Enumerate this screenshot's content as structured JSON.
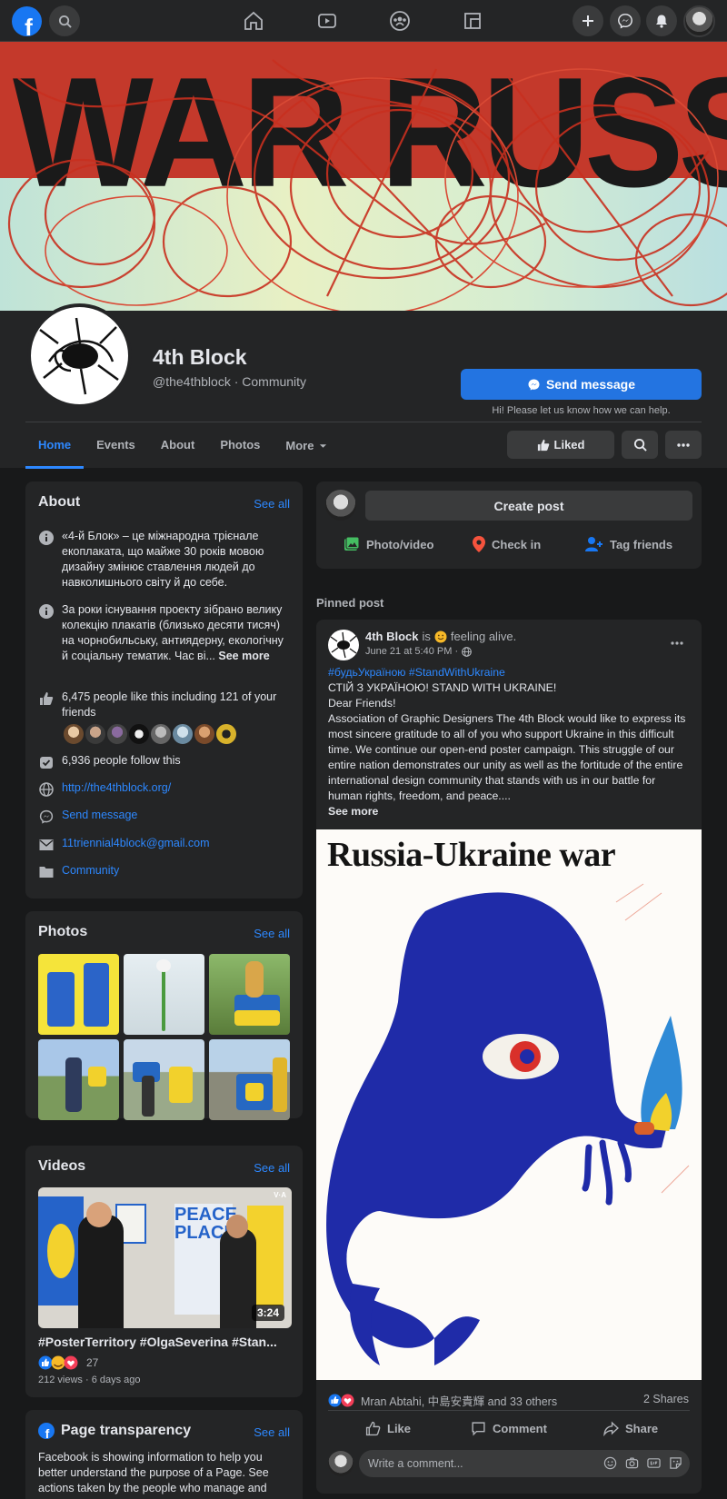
{
  "nav": {
    "logo": "f",
    "icons": [
      "search-icon",
      "home-icon",
      "watch-icon",
      "groups-icon",
      "gaming-icon",
      "plus-icon",
      "messenger-icon",
      "notifications-icon",
      "account-avatar"
    ]
  },
  "cover": {
    "text": "WAR RUSSIA"
  },
  "page": {
    "name": "4th Block",
    "handle": "@the4thblock · Community",
    "send_message": "Send message",
    "send_hint": "Hi! Please let us know how we can help."
  },
  "tabs": [
    "Home",
    "Events",
    "About",
    "Photos",
    "More"
  ],
  "header_buttons": {
    "liked": "Liked"
  },
  "about": {
    "title": "About",
    "see_all": "See all",
    "description1": "«4-й Блок» – це міжнародна трієнале екоплаката, що майже 30 років мовою дизайну змінює ставлення людей до навколишнього світу й до себе.",
    "description2": "За роки існування проекту зібрано велику колекцію плакатів (близько десяти тисяч) на чорнобильську, антиядерну, екологічну й соціальну тематик. Час ві...",
    "see_more": "See more",
    "likes": "6,475 people like this including 121 of your friends",
    "follows": "6,936 people follow this",
    "website": "http://the4thblock.org/",
    "send_message": "Send message",
    "email": "11triennial4block@gmail.com",
    "category": "Community"
  },
  "photos": {
    "title": "Photos",
    "see_all": "See all"
  },
  "videos": {
    "title": "Videos",
    "see_all": "See all",
    "duration": "3:24",
    "watermark": "V·A",
    "caption": "#PosterTerritory #OlgaSeverina #Stan...",
    "reactions": "27",
    "meta": "212 views · 6 days ago",
    "poster_text": "PEACE PLACE"
  },
  "transparency": {
    "title": "Page transparency",
    "see_all": "See all",
    "text": "Facebook is showing information to help you better understand the purpose of a Page. See actions taken by the people who manage and"
  },
  "composer": {
    "create_post": "Create post",
    "photo_video": "Photo/video",
    "check_in": "Check in",
    "tag_friends": "Tag friends"
  },
  "post": {
    "pinned_label": "Pinned post",
    "author": "4th Block",
    "is": "is",
    "feeling": "feeling alive.",
    "time": "June 21 at 5:40 PM ·",
    "hashtags": "#будьУкраїною #StandWithUkraine",
    "line1": "СТІЙ З УКРАЇНОЮ! STAND WITH UKRAINE!",
    "line2": "Dear Friends!",
    "body": "Association of Graphic Designers The 4th Block would like to express its most sincere gratitude to all of you who support Ukraine in this difficult time. We continue our open-end poster campaign. This struggle of our entire nation demonstrates our unity as well as the fortitude of the entire international design community that stands with us in our battle for human rights, freedom, and peace....",
    "see_more": "See more",
    "image_title": "Russia-Ukraine war",
    "reactions": "Mran Abtahi, 中島安貴輝 and 33 others",
    "shares": "2 Shares",
    "like": "Like",
    "comment": "Comment",
    "share": "Share",
    "comment_placeholder": "Write a comment..."
  }
}
